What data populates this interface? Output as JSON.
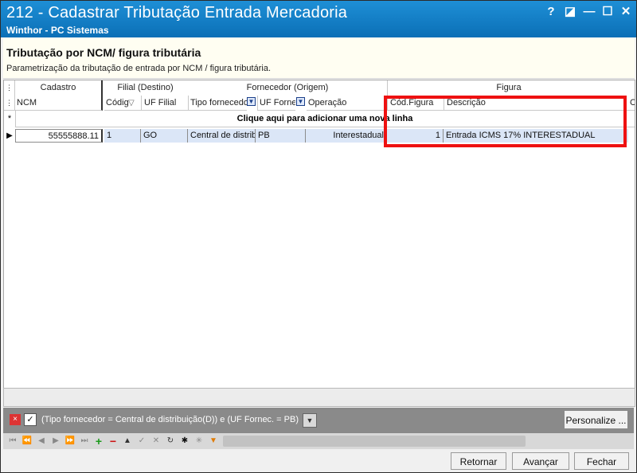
{
  "window": {
    "title": "212 - Cadastrar Tributação Entrada Mercadoria",
    "subtitle": "Winthor - PC Sistemas",
    "controls": [
      "?",
      "◪",
      "—",
      "☐",
      "✕"
    ]
  },
  "header": {
    "title": "Tributação por NCM/ figura tributária",
    "description": "Parametrização da tributação de entrada por NCM / figura tributária."
  },
  "grid": {
    "bands": [
      "Cadastro",
      "Filial (Destino)",
      "Fornecedor (Origem)",
      "Figura"
    ],
    "columns": [
      "NCM",
      "Códig",
      "UF Filial",
      "Tipo fornecedor",
      "UF Fornec.",
      "Operação",
      "Cód.Figura",
      "Descrição",
      "C"
    ],
    "new_row_text": "Clique aqui para adicionar uma nova linha",
    "rows": [
      {
        "ncm": "55555888.11",
        "codigo": "1",
        "uf_filial": "GO",
        "tipo_fornecedor": "Central de distrib",
        "uf_fornec": "PB",
        "operacao": "Interestadual",
        "cod_figura": "1",
        "descricao": "Entrada ICMS 17% INTERESTADUAL"
      }
    ]
  },
  "filter": {
    "text": "(Tipo fornecedor = Central de distribuição(D)) e (UF Fornec. = PB)",
    "personalize_label": "Personalize ..."
  },
  "buttons": {
    "retornar": "Retornar",
    "avancar": "Avançar",
    "fechar": "Fechar"
  },
  "colors": {
    "title_bar": "#1583cc",
    "highlight_box": "#ee1111",
    "selected_row": "#dbe6f7"
  }
}
